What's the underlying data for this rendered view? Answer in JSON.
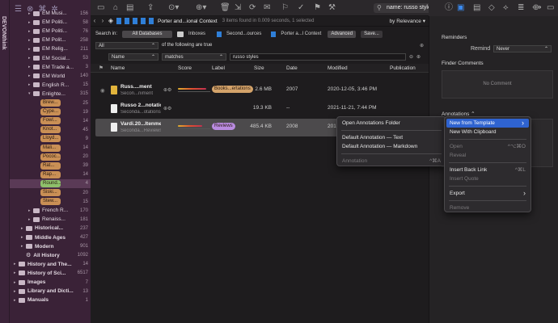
{
  "app_strip": {
    "label": "DEVONthink"
  },
  "sidebar": {
    "rows": [
      {
        "label": "EM Musi...",
        "count": "156",
        "indent": 2,
        "kind": "folder"
      },
      {
        "label": "EM Politi...",
        "count": "58",
        "indent": 2,
        "kind": "folder"
      },
      {
        "label": "EM Politi...",
        "count": "76",
        "indent": 2,
        "kind": "folder"
      },
      {
        "label": "EM Polit...",
        "count": "258",
        "indent": 2,
        "kind": "folder"
      },
      {
        "label": "EM Relig...",
        "count": "211",
        "indent": 2,
        "kind": "folder"
      },
      {
        "label": "EM Social...",
        "count": "53",
        "indent": 2,
        "kind": "folder"
      },
      {
        "label": "EM Trade a...",
        "count": "3",
        "indent": 2,
        "kind": "folder"
      },
      {
        "label": "EM World",
        "count": "140",
        "indent": 2,
        "kind": "folder"
      },
      {
        "label": "English R...",
        "count": "15",
        "indent": 2,
        "kind": "folder"
      },
      {
        "label": "Enlighte...",
        "count": "315",
        "indent": 2,
        "kind": "folder",
        "open": true
      },
      {
        "label": "Brew...",
        "count": "25",
        "indent": 3,
        "kind": "tag"
      },
      {
        "label": "Cype...",
        "count": "19",
        "indent": 3,
        "kind": "tag"
      },
      {
        "label": "Fowl...",
        "count": "14",
        "indent": 3,
        "kind": "tag"
      },
      {
        "label": "Knot...",
        "count": "45",
        "indent": 3,
        "kind": "tag"
      },
      {
        "label": "Lloyd...",
        "count": "9",
        "indent": 3,
        "kind": "tag"
      },
      {
        "label": "Mali...",
        "count": "14",
        "indent": 3,
        "kind": "tag"
      },
      {
        "label": "Pococ...",
        "count": "20",
        "indent": 3,
        "kind": "tag"
      },
      {
        "label": "Rat...",
        "count": "39",
        "indent": 3,
        "kind": "tag"
      },
      {
        "label": "Rap...",
        "count": "14",
        "indent": 3,
        "kind": "tag"
      },
      {
        "label": "Round...",
        "count": "4",
        "indent": 3,
        "kind": "tag-green",
        "selected": true
      },
      {
        "label": "Siski...",
        "count": "20",
        "indent": 3,
        "kind": "tag"
      },
      {
        "label": "Stew...",
        "count": "15",
        "indent": 3,
        "kind": "tag"
      },
      {
        "label": "French R...",
        "count": "170",
        "indent": 2,
        "kind": "folder"
      },
      {
        "label": "Renaiss...",
        "count": "181",
        "indent": 2,
        "kind": "folder"
      },
      {
        "label": "Historical...",
        "count": "237",
        "indent": 1,
        "kind": "folder"
      },
      {
        "label": "Middle Ages",
        "count": "427",
        "indent": 1,
        "kind": "folder"
      },
      {
        "label": "Modern",
        "count": "901",
        "indent": 1,
        "kind": "folder"
      },
      {
        "label": "All History",
        "count": "1092",
        "indent": 1,
        "kind": "smart"
      },
      {
        "label": "History and The...",
        "count": "14",
        "indent": 0,
        "kind": "folder"
      },
      {
        "label": "History of Sci...",
        "count": "6517",
        "indent": 0,
        "kind": "folder"
      },
      {
        "label": "Images",
        "count": "7",
        "indent": 0,
        "kind": "folder"
      },
      {
        "label": "Library and Dicti...",
        "count": "13",
        "indent": 0,
        "kind": "folder"
      },
      {
        "label": "Manuals",
        "count": "1",
        "indent": 0,
        "kind": "folder"
      }
    ]
  },
  "toolbar": {
    "search_value": "name: russo styles"
  },
  "pathbar": {
    "crumb": "Porter and...ional Context",
    "status": "3 items found in 0.009 seconds, 1 selected",
    "sort": "by Relevance"
  },
  "search": {
    "search_in_label": "Search in:",
    "scopes": [
      "All Databases",
      "Inboxes",
      "Second...ources",
      "Porter a...l Context"
    ],
    "advanced": "Advanced",
    "save": "Save...",
    "any_all": "All",
    "any_all_suffix": "of the following are true",
    "field": "Name",
    "operator": "matches",
    "value": "russo styles"
  },
  "columns": {
    "name": "Name",
    "score": "Score",
    "label": "Label",
    "size": "Size",
    "date": "Date",
    "modified": "Modified",
    "publication": "Publication"
  },
  "rows": [
    {
      "title": "Russ....ment",
      "subtitle": "Secon...niment",
      "label": "Books...ertations",
      "label_color": "#d4a36a",
      "size": "2.6 MB",
      "date": "2007",
      "modified": "2020-12-05, 3:46 PM",
      "score": 0.7
    },
    {
      "title": "Russo 2...notation)",
      "subtitle": "Seconda...otations",
      "label": "",
      "size": "19.3 KB",
      "date": "--",
      "modified": "2021-11-21, 7:44 PM",
      "score": 0
    },
    {
      "title": "Vardi.20...Itenment",
      "subtitle": "Seconda...Reviews",
      "label": "Reviews",
      "label_color": "#b98be0",
      "size": "485.4 KB",
      "date": "2008",
      "modified": "2016-02-04, 1:37 PM",
      "score": 0.6,
      "selected": true
    }
  ],
  "inspector": {
    "reminders": "Reminders",
    "remind_label": "Remind",
    "remind_value": "Never",
    "finder_comments": "Finder Comments",
    "no_comment": "No Comment",
    "annotations": "Annotations"
  },
  "context_menu": {
    "items": [
      {
        "label": "Open Annotations Folder"
      },
      {
        "sep": true
      },
      {
        "label": "Default Annotation — Text"
      },
      {
        "label": "Default Annotation — Markdown"
      },
      {
        "sep": true
      },
      {
        "label": "Annotation",
        "shortcut": "^⌘A",
        "disabled": true
      }
    ]
  },
  "submenu": {
    "items": [
      {
        "label": "New from Template",
        "highlight": true,
        "arrow": true
      },
      {
        "label": "New With Clipboard"
      },
      {
        "sep": true
      },
      {
        "label": "Open",
        "shortcut": "^⌥⌘O",
        "disabled": true
      },
      {
        "label": "Reveal",
        "disabled": true
      },
      {
        "sep": true
      },
      {
        "label": "Insert Back Link",
        "shortcut": "^⌘L"
      },
      {
        "label": "Insert Quote",
        "disabled": true
      },
      {
        "sep": true
      },
      {
        "label": "Export",
        "arrow": true
      },
      {
        "sep": true
      },
      {
        "label": "Remove",
        "disabled": true
      }
    ]
  }
}
